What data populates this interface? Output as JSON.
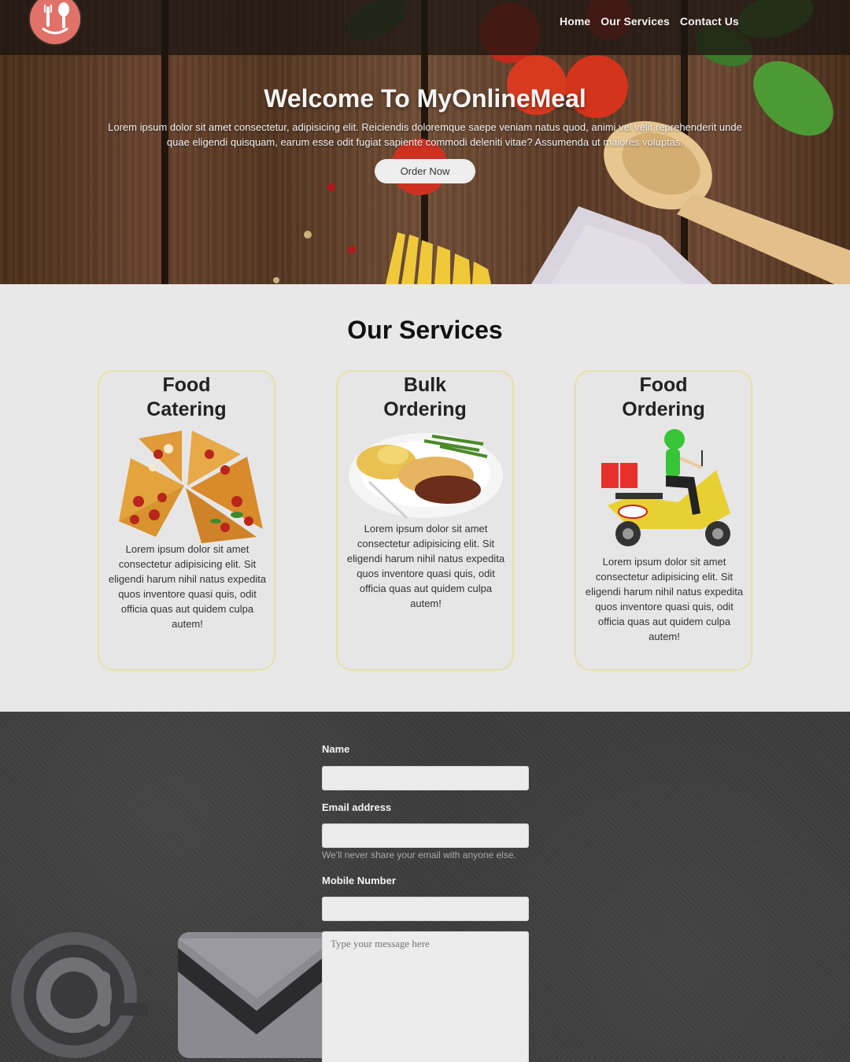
{
  "nav": {
    "logo": "logo-icon",
    "links": [
      "Home",
      "Our Services",
      "Contact Us"
    ]
  },
  "hero": {
    "title": "Welcome To MyOnlineMeal",
    "text": "Lorem ipsum dolor sit amet consectetur, adipisicing elit. Reiciendis doloremque saepe veniam natus quod, animi vel velit reprehenderit unde quae eligendi quisquam, earum esse odit fugiat sapiente commodi deleniti vitae? Assumenda ut maiores voluptas.",
    "button": "Order Now"
  },
  "services": {
    "heading": "Our Services",
    "cards": [
      {
        "title": "Food Catering",
        "image": "pizza-image",
        "text": "Lorem ipsum dolor sit amet consectetur adipisicing elit. Sit eligendi harum nihil natus expedita quos inventore quasi quis, odit officia quas aut quidem culpa autem!"
      },
      {
        "title": "Bulk Ordering",
        "image": "meal-plate-image",
        "text": "Lorem ipsum dolor sit amet consectetur adipisicing elit. Sit eligendi harum nihil natus expedita quos inventore quasi quis, odit officia quas aut quidem culpa autem!"
      },
      {
        "title": "Food Ordering",
        "image": "delivery-scooter-image",
        "text": "Lorem ipsum dolor sit amet consectetur adipisicing elit. Sit eligendi harum nihil natus expedita quos inventore quasi quis, odit officia quas aut quidem culpa autem!"
      }
    ]
  },
  "contact": {
    "name_label": "Name",
    "email_label": "Email address",
    "email_help": "We'll never share your email with anyone else.",
    "mobile_label": "Mobile Number",
    "message_placeholder": "Type your message here"
  },
  "colors": {
    "logo": "#e1726a",
    "card_border": "#e5e0a6",
    "navbar": "#1c1612"
  }
}
